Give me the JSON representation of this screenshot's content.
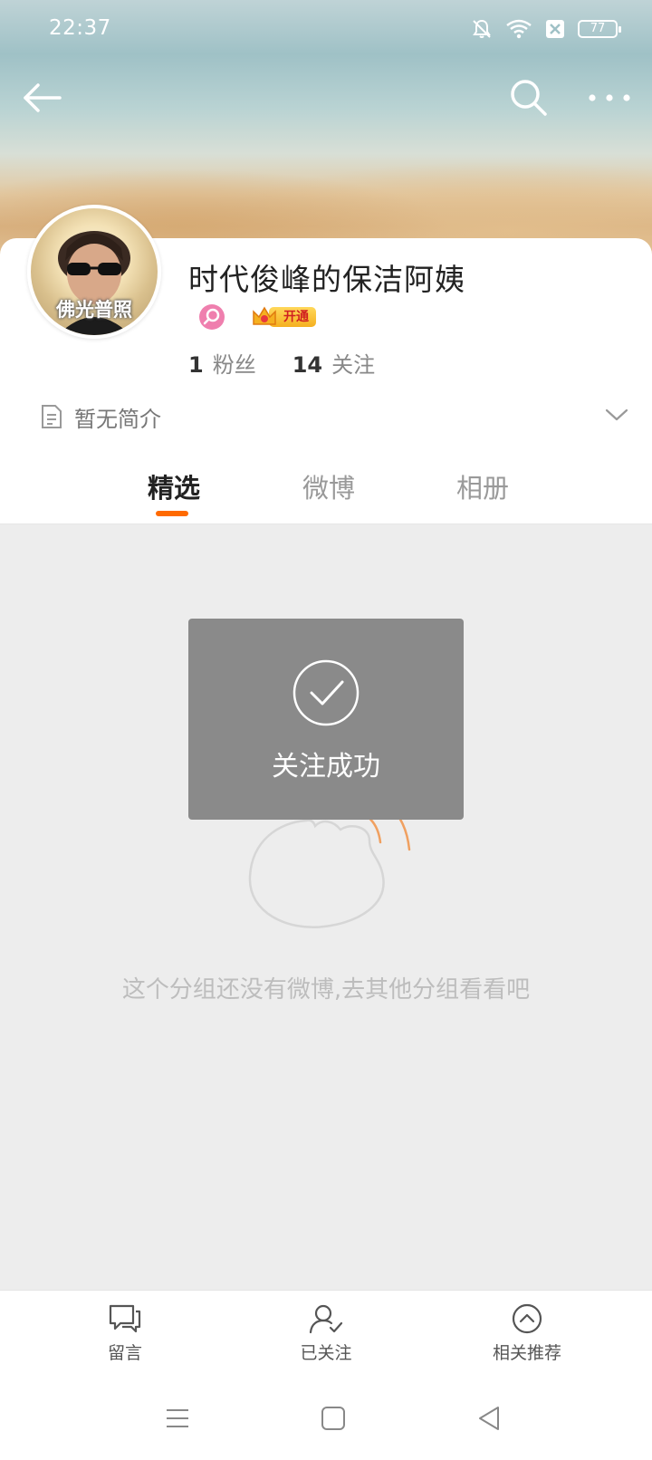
{
  "status_bar": {
    "time": "22:37",
    "battery": "77"
  },
  "profile": {
    "username": "时代俊峰的保洁阿姨",
    "avatar_caption": "佛光普照",
    "vip_button": "开通",
    "fans_count": "1",
    "fans_label": "粉丝",
    "following_count": "14",
    "following_label": "关注",
    "bio": "暂无简介"
  },
  "tabs": [
    {
      "label": "精选",
      "active": true
    },
    {
      "label": "微博",
      "active": false
    },
    {
      "label": "相册",
      "active": false
    }
  ],
  "toast": {
    "message": "关注成功"
  },
  "empty_state": {
    "message": "这个分组还没有微博,去其他分组看看吧"
  },
  "bottom_bar": {
    "items": [
      {
        "label": "留言",
        "icon": "message-icon"
      },
      {
        "label": "已关注",
        "icon": "user-followed-icon"
      },
      {
        "label": "相关推荐",
        "icon": "chevron-up-circle-icon"
      }
    ]
  },
  "colors": {
    "accent": "#ff6a00",
    "toast_bg": "#8a8a8a",
    "background": "#ededed"
  }
}
